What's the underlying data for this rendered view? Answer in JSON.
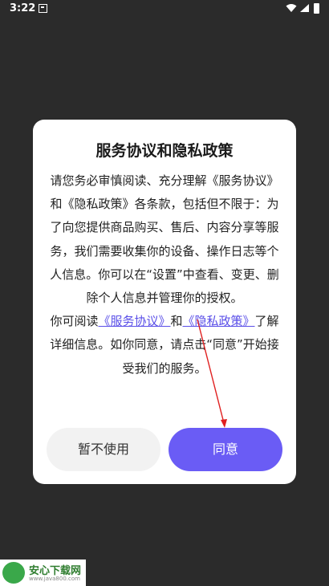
{
  "status_bar": {
    "time": "3:22"
  },
  "dialog": {
    "title": "服务协议和隐私政策",
    "paragraph1": "请您务必审慎阅读、充分理解《服务协议》和《隐私政策》各条款，包括但不限于：为了向您提供商品购买、售后、内容分享等服务，我们需要收集你的设备、操作日志等个人信息。你可以在“设置”中查看、变更、删除个人信息并管理你的授权。",
    "p2_prefix": "你可阅读",
    "p2_link1": "《服务协议》",
    "p2_and": "和",
    "p2_link2": "《隐私政策》",
    "p2_suffix": "了解详细信息。如你同意，请点击“同意”开始接受我们的服务。",
    "decline_label": "暂不使用",
    "agree_label": "同意"
  },
  "watermark": {
    "brand": "安心下载网",
    "url": "www.java800.com"
  },
  "colors": {
    "accent": "#6a5cf5",
    "link": "#5a4fe8",
    "arrow": "#e02020",
    "backdrop": "#2b2b2b"
  },
  "icons": [
    "notification-icon",
    "wifi-icon",
    "signal-icon",
    "battery-icon",
    "annotation-arrow",
    "watermark-logo-icon"
  ]
}
